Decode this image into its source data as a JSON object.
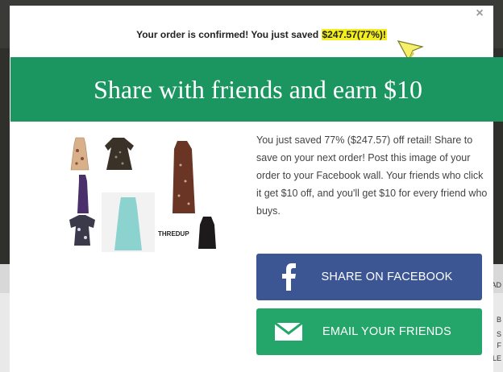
{
  "background": {
    "right_labels": [
      "AD",
      "B",
      "S",
      "F",
      "LE"
    ]
  },
  "modal": {
    "close_symbol": "×",
    "confirmation": {
      "prefix": "Your order is confirmed! You just saved ",
      "highlight": "$247.57(77%)!"
    },
    "banner_title": "Share with friends and earn $10",
    "product_image": {
      "logo_text": "THREDUP"
    },
    "description": "You just saved 77% ($247.57) off retail! Share to save on your next order! Post this image of your order to your Facebook wall. Your friends who click it get $10 off, and you'll get $10 for every friend who buys.",
    "buttons": {
      "facebook": {
        "label": "SHARE ON FACEBOOK",
        "icon": "facebook-f-icon",
        "color": "#3c5593"
      },
      "email": {
        "label": "EMAIL YOUR FRIENDS",
        "icon": "envelope-icon",
        "color": "#24a66a"
      }
    },
    "colors": {
      "banner": "#1c9660",
      "highlight": "#f4ee1c"
    }
  }
}
